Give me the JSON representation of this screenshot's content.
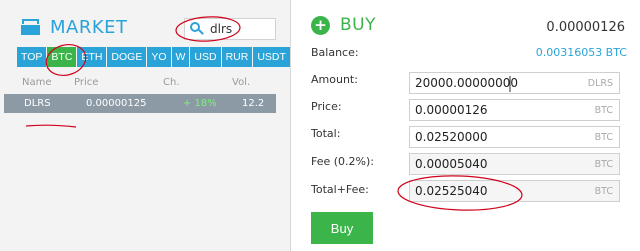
{
  "market": {
    "title": "MARKET",
    "icon": "market-icon",
    "search": {
      "value": "dlrs",
      "icon": "search-icon"
    },
    "tabs": [
      "TOP",
      "BTC",
      "ETH",
      "DOGE",
      "YO",
      "W",
      "USD",
      "RUR",
      "USDT"
    ],
    "active_tab": "BTC",
    "columns": {
      "name": "Name",
      "price": "Price",
      "change": "Ch.",
      "volume": "Vol."
    },
    "rows": [
      {
        "name": "DLRS",
        "price": "0.00000125",
        "change": "+ 18%",
        "volume": "12.2"
      }
    ]
  },
  "buy": {
    "title": "BUY",
    "icon": "plus-circle-icon",
    "price": "0.00000126",
    "balance": {
      "label": "Balance:",
      "value": "0.00316053 BTC"
    },
    "fields": {
      "amount": {
        "label": "Amount:",
        "value": "20000.00000000",
        "unit": "DLRS"
      },
      "price": {
        "label": "Price:",
        "value": "0.00000126",
        "unit": "BTC"
      },
      "total": {
        "label": "Total:",
        "value": "0.02520000",
        "unit": "BTC"
      },
      "fee": {
        "label": "Fee (0.2%):",
        "value": "0.00005040",
        "unit": "BTC"
      },
      "total_fee": {
        "label": "Total+Fee:",
        "value": "0.02525040",
        "unit": "BTC"
      }
    },
    "button_label": "Buy"
  },
  "colors": {
    "accent_blue": "#2aa3d8",
    "accent_green": "#3bb54a",
    "annotation_red": "#d0021b",
    "selected_row": "#8c9aa6"
  }
}
